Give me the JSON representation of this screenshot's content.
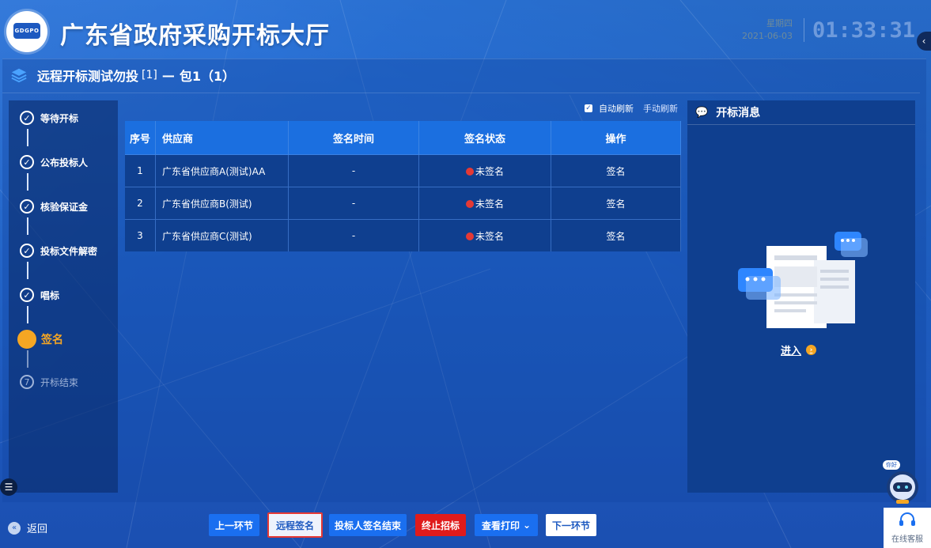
{
  "header": {
    "logo_text": "GDGPO",
    "title": "广东省政府采购开标大厅",
    "weekday": "星期四",
    "date": "2021-06-03",
    "time": "01:33:31",
    "collapse_icon": "chevron-left-icon"
  },
  "project": {
    "name": "远程开标测试勿投",
    "index": "[1]",
    "separator": "—",
    "package": "包1（1）"
  },
  "steps": [
    {
      "label": "等待开标",
      "state": "done"
    },
    {
      "label": "公布投标人",
      "state": "done"
    },
    {
      "label": "核验保证金",
      "state": "done"
    },
    {
      "label": "投标文件解密",
      "state": "done"
    },
    {
      "label": "唱标",
      "state": "done"
    },
    {
      "label": "签名",
      "state": "active"
    },
    {
      "label": "开标结束",
      "state": "todo",
      "number": "7"
    }
  ],
  "refresh": {
    "auto_label": "自动刷新",
    "auto_checked": true,
    "manual_label": "手动刷新"
  },
  "table": {
    "headers": [
      "序号",
      "供应商",
      "签名时间",
      "签名状态",
      "操作"
    ],
    "rows": [
      {
        "no": "1",
        "supplier": "广东省供应商A(测试)AA",
        "time": "-",
        "status": "未签名",
        "action": "签名"
      },
      {
        "no": "2",
        "supplier": "广东省供应商B(测试)",
        "time": "-",
        "status": "未签名",
        "action": "签名"
      },
      {
        "no": "3",
        "supplier": "广东省供应商C(测试)",
        "time": "-",
        "status": "未签名",
        "action": "签名"
      }
    ]
  },
  "news": {
    "title": "开标消息",
    "enter_label": "进入"
  },
  "robot": {
    "bubble": "你好"
  },
  "bottom": {
    "back_label": "返回",
    "buttons": {
      "prev": "上一环节",
      "remote_sign": "远程签名",
      "sign_end": "投标人签名结束",
      "terminate": "终止招标",
      "print": "查看打印",
      "next": "下一环节"
    },
    "service_label": "在线客服"
  },
  "colors": {
    "background": "#1f62c8",
    "accent": "#f5a623",
    "danger": "#e01b1b",
    "status_unsigned": "#e53935",
    "table_header": "#1b6fe0",
    "table_row": "#0f3f8f"
  }
}
